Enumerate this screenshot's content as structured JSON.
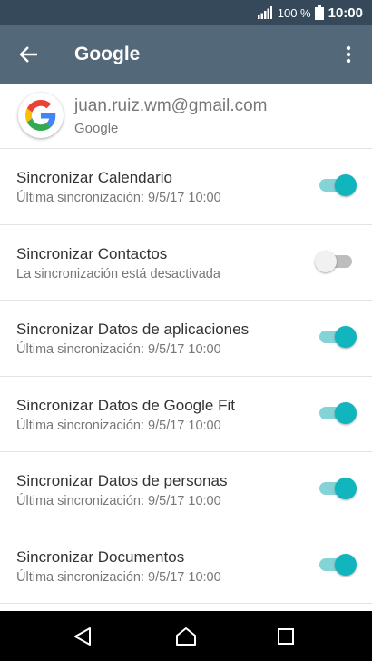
{
  "status_bar": {
    "battery_percent": "100 %",
    "time": "10:00",
    "icons": [
      "signal-icon",
      "battery-icon"
    ]
  },
  "app_bar": {
    "title": "Google",
    "icons": [
      "back-arrow-icon",
      "more-vert-icon"
    ]
  },
  "account": {
    "email": "juan.ruiz.wm@gmail.com",
    "type": "Google",
    "icon": "google-logo-icon"
  },
  "sync_items": [
    {
      "title": "Sincronizar Calendario",
      "subtitle": "Última sincronización: 9/5/17 10:00",
      "enabled": true
    },
    {
      "title": "Sincronizar Contactos",
      "subtitle": "La sincronización está desactivada",
      "enabled": false
    },
    {
      "title": "Sincronizar Datos de aplicaciones",
      "subtitle": "Última sincronización: 9/5/17 10:00",
      "enabled": true
    },
    {
      "title": "Sincronizar Datos de Google Fit",
      "subtitle": "Última sincronización: 9/5/17 10:00",
      "enabled": true
    },
    {
      "title": "Sincronizar Datos de personas",
      "subtitle": "Última sincronización: 9/5/17 10:00",
      "enabled": true
    },
    {
      "title": "Sincronizar Documentos",
      "subtitle": "Última sincronización: 9/5/17 10:00",
      "enabled": true
    }
  ],
  "nav_bar": {
    "icons": [
      "nav-back-icon",
      "nav-home-icon",
      "nav-recents-icon"
    ]
  },
  "colors": {
    "status_bar": "#35495a",
    "app_bar": "#536879",
    "toggle_on_thumb": "#10b5bd",
    "toggle_on_track": "#84d3d7",
    "toggle_off_thumb": "#f1f1f1",
    "toggle_off_track": "#bdbdbd"
  }
}
